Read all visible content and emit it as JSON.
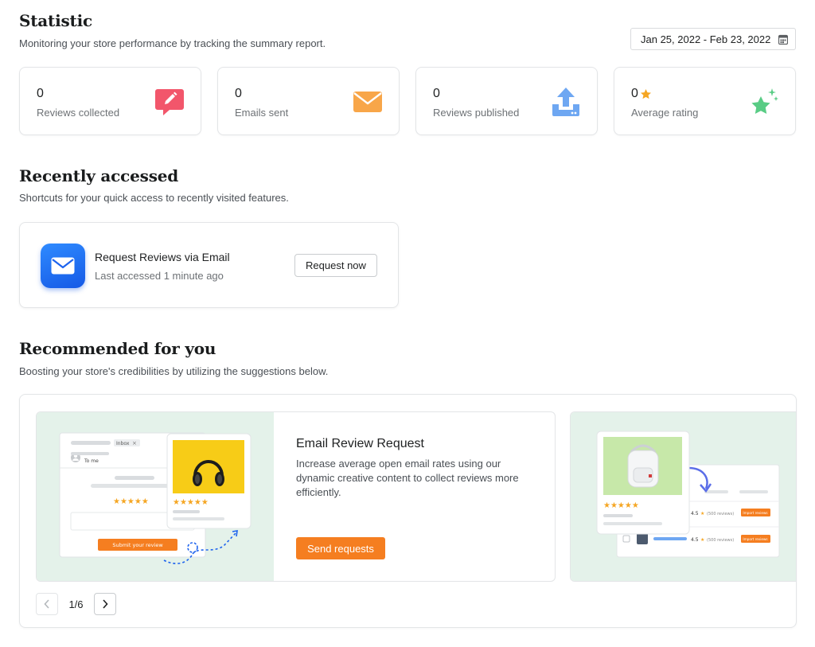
{
  "statistic": {
    "title": "Statistic",
    "subtitle": "Monitoring your store performance by tracking the summary report.",
    "date_range": "Jan 25, 2022 - Feb 23, 2022",
    "cards": [
      {
        "value": "0",
        "label": "Reviews collected",
        "icon": "edit-bubble-icon",
        "color": "#f2566b"
      },
      {
        "value": "0",
        "label": "Emails sent",
        "icon": "envelope-icon",
        "color": "#f8a649"
      },
      {
        "value": "0",
        "label": "Reviews published",
        "icon": "upload-icon",
        "color": "#6ea7f2"
      },
      {
        "value": "0",
        "label": "Average rating",
        "icon": "star-sparkle-icon",
        "color": "#59cc85"
      }
    ]
  },
  "recent": {
    "title": "Recently accessed",
    "subtitle": "Shortcuts for your quick access to recently visited features.",
    "item": {
      "name": "Request Reviews via Email",
      "last_accessed": "Last accessed 1 minute ago",
      "action_label": "Request now"
    }
  },
  "recommended": {
    "title": "Recommended for you",
    "subtitle": "Boosting your store's credibilities by utilizing the suggestions below.",
    "slides": [
      {
        "title": "Email Review Request",
        "description": "Increase average open email rates using our dynamic creative content to collect reviews more efficiently.",
        "action_label": "Send requests",
        "illustration": {
          "inbox_tag": "Inbox",
          "recipient": "To me",
          "submit_label": "Submit your review"
        }
      },
      {
        "illustration": {
          "rows": [
            {
              "rating": "4.5",
              "reviews": "(500 reviews)",
              "action": "Import reviews"
            },
            {
              "rating": "4.5",
              "reviews": "(500 reviews)",
              "action": "Import reviews"
            }
          ]
        }
      }
    ],
    "pager": {
      "text": "1/6"
    }
  },
  "colors": {
    "accent_orange": "#f57e20",
    "star": "#f5a623",
    "art_bg": "#e4f2ea"
  }
}
